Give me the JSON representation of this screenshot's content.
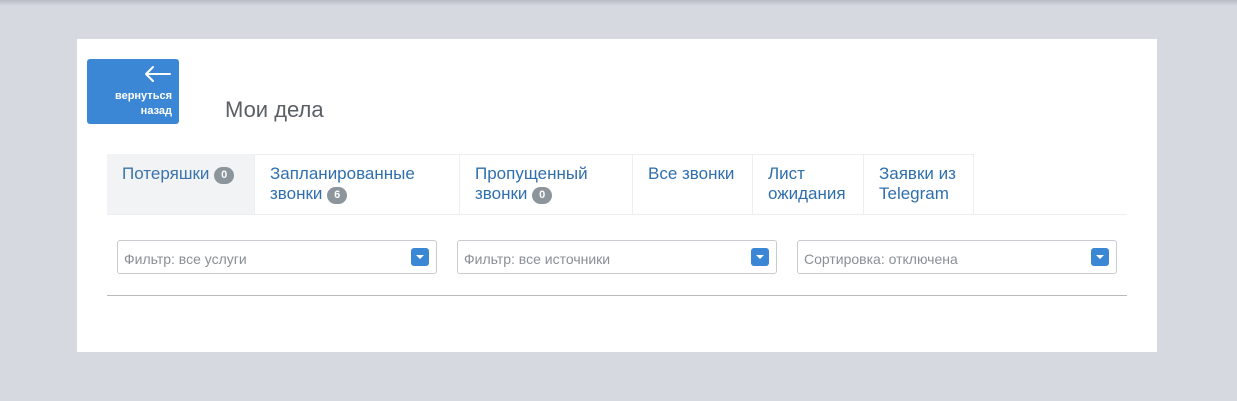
{
  "back_button": {
    "label": "вернуться назад",
    "icon": "arrow-left-icon"
  },
  "page_title": "Мои дела",
  "tabs": [
    {
      "label": "Потеряшки",
      "badge": "0",
      "active": true
    },
    {
      "label": "Запланированные звонки",
      "badge": "6",
      "active": false
    },
    {
      "label": "Пропущенный звонки",
      "badge": "0",
      "active": false
    },
    {
      "label": "Все звонки",
      "badge": null,
      "active": false
    },
    {
      "label": "Лист ожидания",
      "badge": null,
      "active": false
    },
    {
      "label": "Заявки из Telegram",
      "badge": null,
      "active": false
    }
  ],
  "filters": {
    "services": "Фильтр: все услуги",
    "sources": "Фильтр: все источники",
    "sorting": "Сортировка: отключена"
  },
  "colors": {
    "accent": "#3b87d6",
    "badge": "#8c949c",
    "tab_text": "#2f6fad",
    "background": "#d6d9e0"
  }
}
